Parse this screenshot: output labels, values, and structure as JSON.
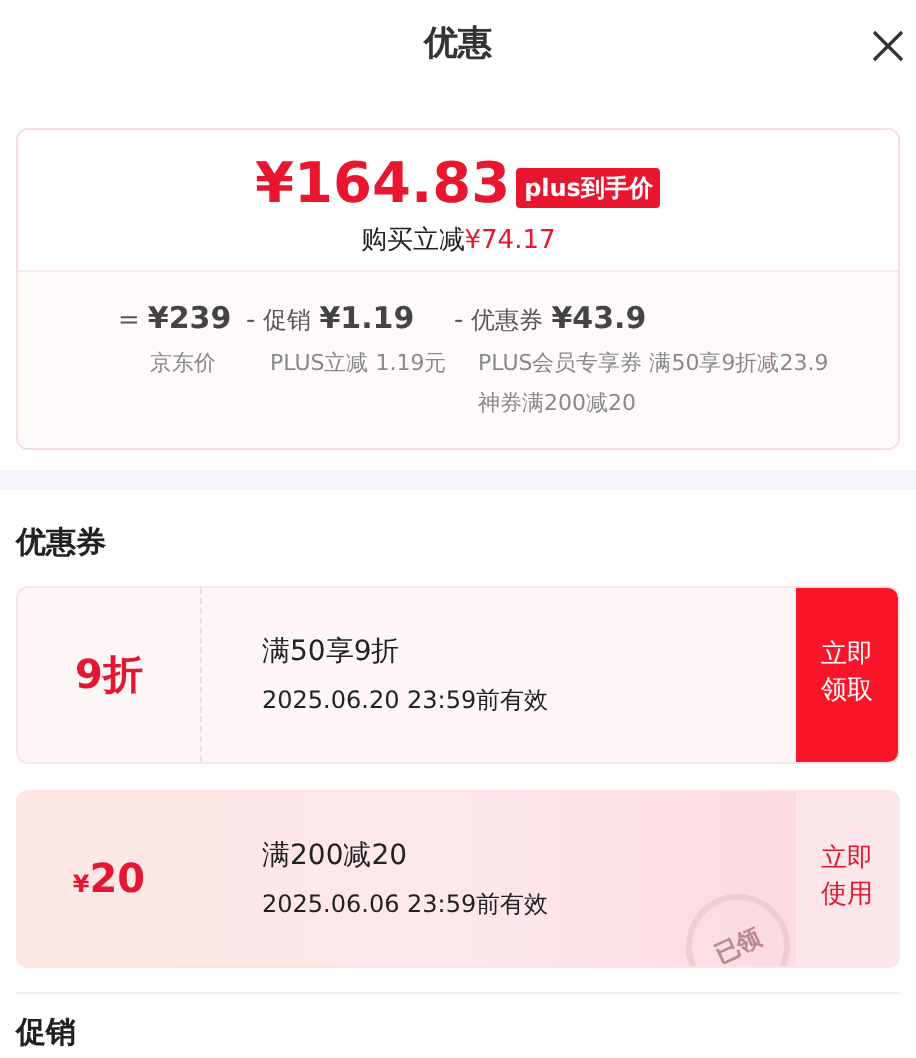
{
  "header": {
    "title": "优惠"
  },
  "price_card": {
    "price": "¥164.83",
    "price_tag": "plus到手价",
    "saving_label": "购买立减",
    "saving_amount": "¥74.17",
    "breakdown": [
      {
        "operator": "=",
        "amount": "¥239",
        "notes": [
          "京东价"
        ]
      },
      {
        "operator": "-",
        "label": "促销",
        "amount": "¥1.19",
        "notes": [
          "PLUS立减 1.19元"
        ]
      },
      {
        "operator": "-",
        "label": "优惠券",
        "amount": "¥43.9",
        "notes": [
          "PLUS会员专享券 满50享9折减23.9",
          "神券满200减20"
        ]
      }
    ]
  },
  "coupon_section": {
    "heading": "优惠券"
  },
  "coupons": [
    {
      "kind": "get",
      "value": "9折",
      "title": "满50享9折",
      "validity": "2025.06.20 23:59前有效",
      "action": "立即领取"
    },
    {
      "kind": "use",
      "currency": "¥",
      "value": "20",
      "title": "满200减20",
      "validity": "2025.06.06 23:59前有效",
      "action": "立即使用",
      "stamp": "已领"
    }
  ],
  "promo_section": {
    "heading": "促销"
  }
}
